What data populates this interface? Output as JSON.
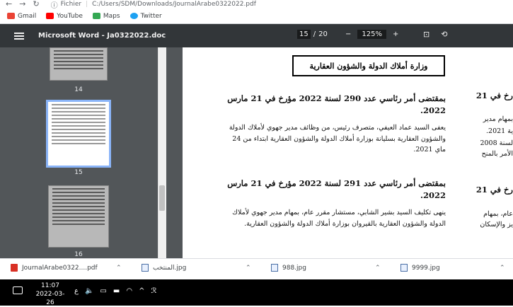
{
  "browser": {
    "info_label": "Fichier",
    "url": "C:/Users/SDM/Downloads/JournalArabe0322022.pdf",
    "bookmarks": [
      "Gmail",
      "YouTube",
      "Maps",
      "Twitter"
    ]
  },
  "pdf_toolbar": {
    "title": "Microsoft Word - Ja0322022.doc",
    "current_page": "15",
    "page_separator": "/",
    "total_pages": "20",
    "zoom": "125%",
    "zoom_out": "−",
    "zoom_in": "+"
  },
  "thumbnails": [
    {
      "label": "14"
    },
    {
      "label": "15"
    },
    {
      "label": "16"
    }
  ],
  "document": {
    "header": "وزارة أملاك الدولة والشؤون العقارية",
    "entries": [
      {
        "heading": "بمقتضى أمر رئاسي عدد 290 لسنة 2022 مؤرخ في 21 مارس 2022.",
        "body": "يعفى السيد عماد العيفي، متصرف رئيس، من وظائف مدير جهوي لأملاك الدولة والشؤون العقارية بسليانة بوزارة أملاك الدولة والشؤون العقارية ابتداء من 24 ماي 2021."
      },
      {
        "heading": "بمقتضى أمر رئاسي عدد 291 لسنة 2022 مؤرخ في 21 مارس 2022.",
        "body": "ينهى تكليف السيد بشير الشابي، مستشار مقرر عام، بمهام مدير جهوي لأملاك الدولة والشؤون العقارية بالقيروان بوزارة أملاك الدولة والشؤون العقارية."
      }
    ],
    "right_fragments": {
      "f1": "رخ في 21",
      "f2": "بمهام مدير",
      "f3": "ية 2021.",
      "f4": "لسنة 2008",
      "f5": "الأمر بالمنح",
      "f6": "رخ في 21",
      "f7": "عام، بمهام",
      "f8": "يز والإسكان"
    }
  },
  "downloads": [
    {
      "name": "JournalArabe0322....pdf",
      "type": "pdf"
    },
    {
      "name": "المنتخب.jpg",
      "type": "image"
    },
    {
      "name": "988.jpg",
      "type": "image"
    },
    {
      "name": "9999.jpg",
      "type": "image"
    }
  ],
  "taskbar": {
    "time": "11:07",
    "date": "2022-03-26",
    "lang": "ع"
  },
  "colors": {
    "toolbar_bg": "#323639",
    "sidebar_bg": "#525659",
    "selected_thumb": "#8ab4f8"
  }
}
